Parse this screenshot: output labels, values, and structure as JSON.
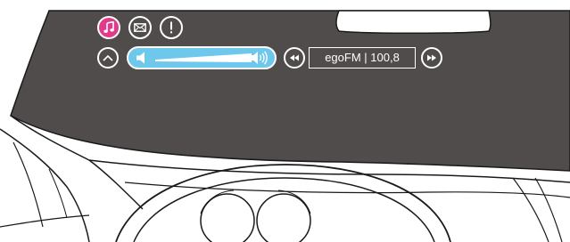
{
  "hud": {
    "top_icons": [
      {
        "icon": "music-note-icon",
        "active": true
      },
      {
        "icon": "message-icon",
        "active": false
      },
      {
        "icon": "alert-icon",
        "active": false
      }
    ],
    "collapse_icon": "chevron-up-icon",
    "volume": {
      "down_icon": "speaker-low-icon",
      "up_icon": "speaker-high-icon"
    },
    "radio": {
      "prev_icon": "rewind-icon",
      "station_label": "egoFM | 100,8",
      "next_icon": "fast-forward-icon"
    }
  },
  "colors": {
    "windshield": "#4f4c4b",
    "accent_pink": "#e23a8a",
    "volume_blue": "#6ec8ec",
    "hud_white": "#ffffff"
  }
}
